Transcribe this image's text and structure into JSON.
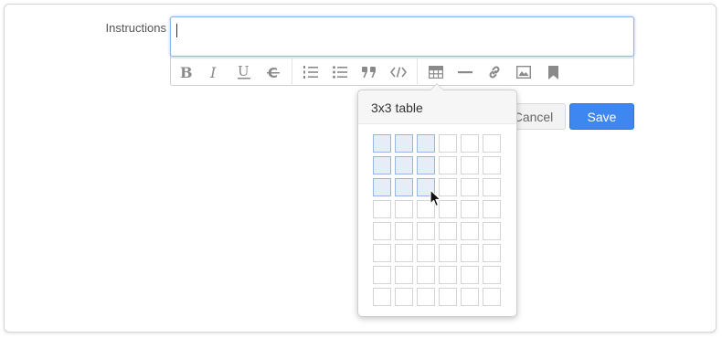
{
  "form": {
    "instructions_label": "Instructions",
    "instructions_value": "",
    "cancel_label": "Cancel",
    "save_label": "Save"
  },
  "toolbar": {
    "icons": [
      "bold-icon",
      "italic-icon",
      "underline-icon",
      "strikethrough-icon",
      "ordered-list-icon",
      "unordered-list-icon",
      "blockquote-icon",
      "code-icon",
      "table-icon",
      "horizontal-rule-icon",
      "link-icon",
      "image-icon",
      "bookmark-icon"
    ]
  },
  "table_picker": {
    "title": "3x3 table",
    "rows": 8,
    "cols": 6,
    "selected_rows": 3,
    "selected_cols": 3
  },
  "colors": {
    "accent": "#3e86f0",
    "selected_cell": "#e5edf9",
    "focus_border": "#8fb3ec"
  }
}
